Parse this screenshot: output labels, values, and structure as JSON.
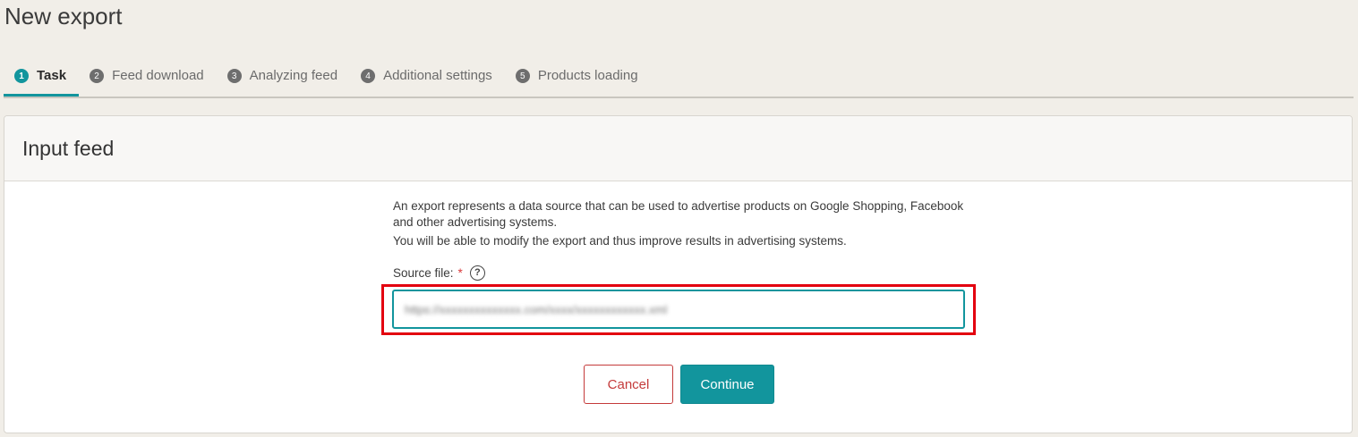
{
  "page": {
    "title": "New export"
  },
  "tabs": [
    {
      "num": "1",
      "label": "Task"
    },
    {
      "num": "2",
      "label": "Feed download"
    },
    {
      "num": "3",
      "label": "Analyzing feed"
    },
    {
      "num": "4",
      "label": "Additional settings"
    },
    {
      "num": "5",
      "label": "Products loading"
    }
  ],
  "active_tab": "Task",
  "panel": {
    "title": "Input feed",
    "intro_line1": "An export represents a data source that can be used to advertise products on Google Shopping, Facebook and other advertising systems.",
    "intro_line2": "You will be able to modify the export and thus improve results in advertising systems.",
    "source_file_label": "Source file:",
    "required_mark": "*",
    "help_glyph": "?",
    "source_file_value": "https://xxxxxxxxxxxxxx.com/xxxx/xxxxxxxxxxxx.xml"
  },
  "buttons": {
    "cancel": "Cancel",
    "continue": "Continue"
  },
  "colors": {
    "accent": "#12959d",
    "danger": "#c43a3a",
    "highlight": "#e3000f",
    "background": "#f1eee8"
  },
  "icons": {
    "help": "question-circle-icon"
  }
}
